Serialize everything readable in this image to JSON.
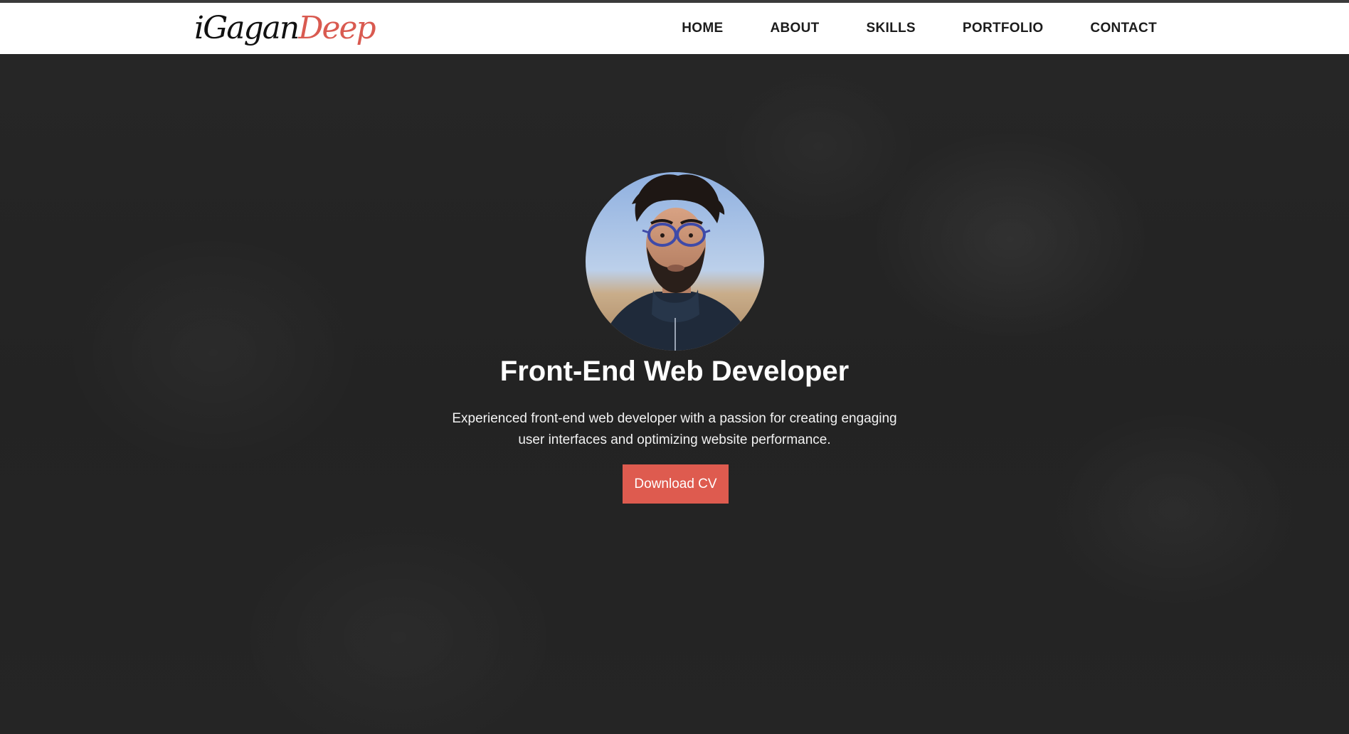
{
  "header": {
    "logo": {
      "part_a": "iGagan",
      "part_b": "Deep"
    },
    "nav": [
      {
        "label": "HOME"
      },
      {
        "label": "ABOUT"
      },
      {
        "label": "SKILLS"
      },
      {
        "label": "PORTFOLIO"
      },
      {
        "label": "CONTACT"
      }
    ]
  },
  "hero": {
    "title": "Front-End Web Developer",
    "description": "Experienced front-end web developer with a passion for creating engaging user interfaces and optimizing website performance.",
    "cta_label": "Download CV"
  },
  "colors": {
    "accent": "#de5b4f",
    "logo_accent": "#d95a50",
    "nav_text": "#1c1c1c",
    "hero_background": "#242424"
  }
}
